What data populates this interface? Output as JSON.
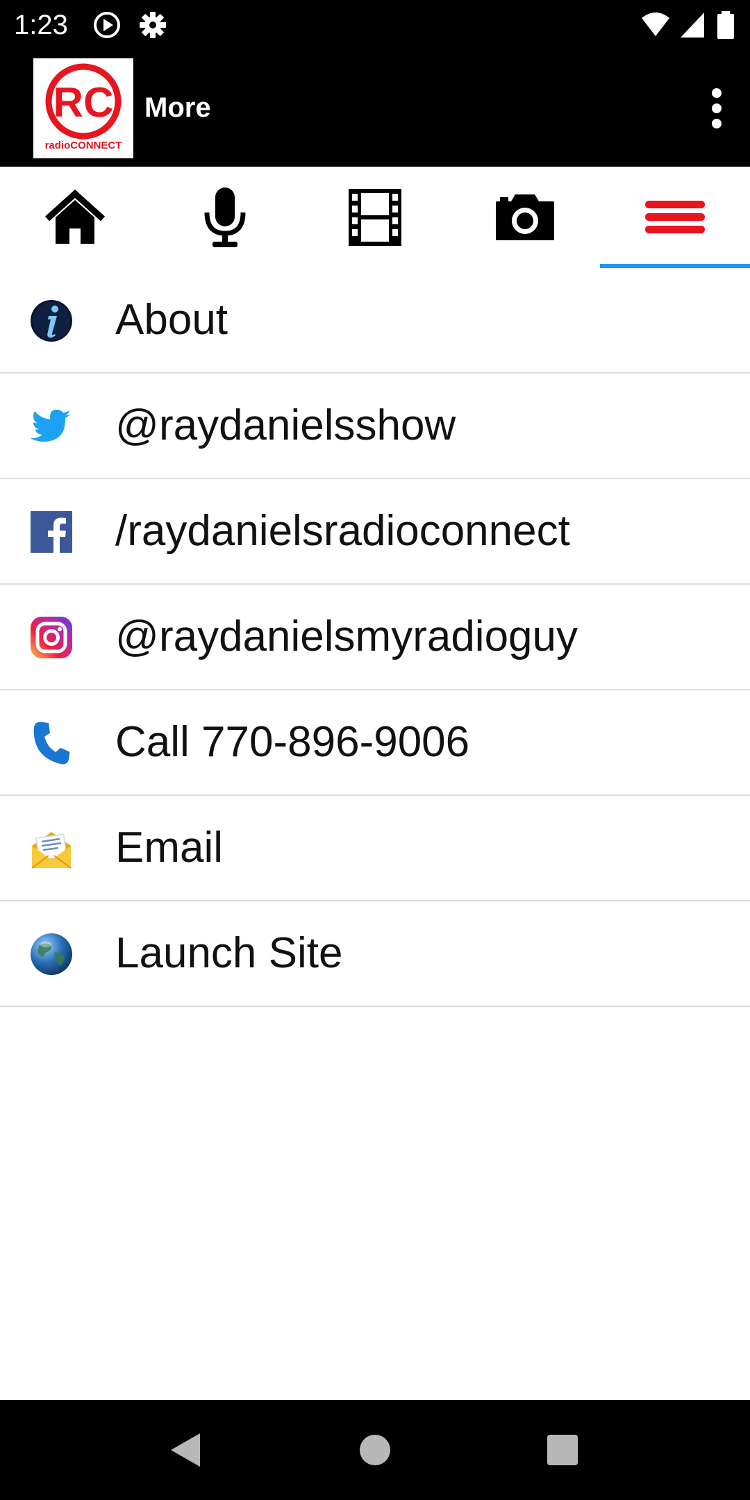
{
  "status_bar": {
    "time": "1:23"
  },
  "app_bar": {
    "logo_text_main": "RC",
    "logo_text_sub": "radioCONNECT",
    "title": "More"
  },
  "tabs": [
    {
      "icon": "home-icon",
      "selected": false
    },
    {
      "icon": "microphone-icon",
      "selected": false
    },
    {
      "icon": "film-icon",
      "selected": false
    },
    {
      "icon": "camera-icon",
      "selected": false
    },
    {
      "icon": "menu-icon",
      "selected": true
    }
  ],
  "menu_items": [
    {
      "label": "About",
      "icon": "info-icon"
    },
    {
      "label": "@raydanielsshow",
      "icon": "twitter-icon"
    },
    {
      "label": "/raydanielsradioconnect",
      "icon": "facebook-icon"
    },
    {
      "label": "@raydanielsmyradioguy",
      "icon": "instagram-icon"
    },
    {
      "label": "Call 770-896-9006",
      "icon": "phone-icon"
    },
    {
      "label": "Email",
      "icon": "email-icon"
    },
    {
      "label": "Launch Site",
      "icon": "globe-icon"
    }
  ],
  "colors": {
    "tab_indicator": "#2196F3",
    "menu_icon_red": "#E8141E",
    "twitter_blue": "#1DA1F2",
    "facebook_blue": "#3B5998",
    "phone_blue": "#1976D2"
  }
}
